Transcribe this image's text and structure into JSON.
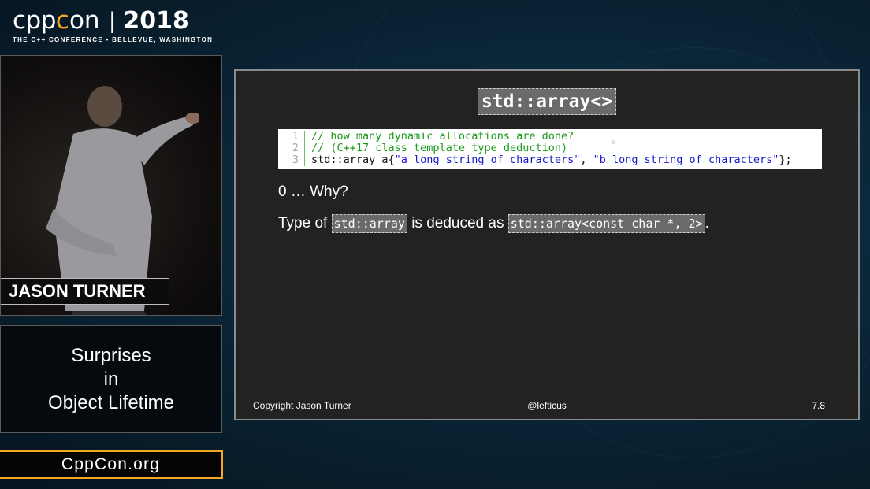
{
  "logo": {
    "brand_prefix": "cpp",
    "brand_o": "c",
    "brand_suffix": "on",
    "separator": "|",
    "year": "2018",
    "tagline": "THE C++ CONFERENCE • BELLEVUE, WASHINGTON"
  },
  "speaker": {
    "name": "JASON TURNER"
  },
  "talk": {
    "title_lines": [
      "Surprises",
      "in",
      "Object Lifetime"
    ]
  },
  "site": {
    "url": "CppCon.org"
  },
  "slide": {
    "title": "std::array<>",
    "code": [
      {
        "num": "1",
        "comment": "// how many dynamic allocations are done?"
      },
      {
        "num": "2",
        "comment": "// (C++17 class template type deduction)"
      },
      {
        "num": "3",
        "prefix": "std::array a{",
        "str1": "\"a long string of characters\"",
        "mid": ", ",
        "str2": "\"b long string of characters\"",
        "suffix": "};"
      }
    ],
    "answer": "0 … Why?",
    "explanation": {
      "part1": "Type of ",
      "code1": "std::array",
      "part2": " is deduced as ",
      "code2": "std::array<const char *, 2>",
      "part3": "."
    },
    "footer": {
      "copyright": "Copyright Jason Turner",
      "handle": "@lefticus",
      "page": "7.8"
    }
  },
  "colors": {
    "accent_orange": "#f5a623",
    "slide_bg": "#222222",
    "code_comment": "#1a9a1a",
    "code_string": "#1a1acd"
  }
}
